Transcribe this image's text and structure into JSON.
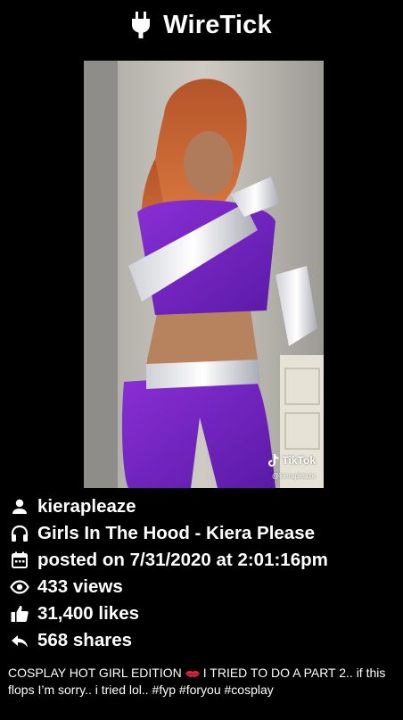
{
  "app": {
    "title": "WireTick",
    "logo_icon": "plug-icon"
  },
  "video": {
    "watermark_brand": "TikTok",
    "watermark_handle": "@kierapleaze"
  },
  "meta": {
    "author": "kierapleaze",
    "sound": "Girls In The Hood - Kiera Please",
    "posted": "posted on 7/31/2020 at 2:01:16pm",
    "views": "433 views",
    "likes": "31,400 likes",
    "shares": "568 shares"
  },
  "caption": {
    "before_emoji": "COSPLAY HOT GIRL EDITION",
    "emoji": "kiss-lips-icon",
    "after_emoji": "I TRIED TO DO A PART 2.. if this flops I’m sorry.. i tried lol.. #fyp #foryou #cosplay"
  },
  "colors": {
    "background": "#000000",
    "text": "#ffffff",
    "lips": "#d7263d"
  }
}
